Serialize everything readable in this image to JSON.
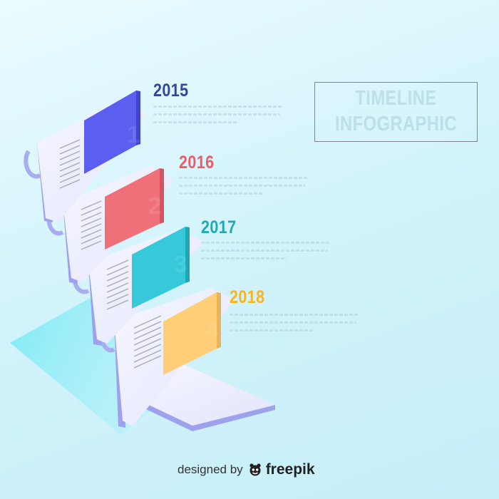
{
  "title": {
    "line1": "TIMELINE",
    "line2": "INFOGRAPHIC"
  },
  "steps": [
    {
      "year": "2015",
      "color": "#5b5ff0",
      "year_color": "#33479a"
    },
    {
      "year": "2016",
      "color": "#f0707a",
      "year_color": "#ec5b67"
    },
    {
      "year": "2017",
      "color": "#35c9da",
      "year_color": "#22a8b4"
    },
    {
      "year": "2018",
      "color": "#ffce77",
      "year_color": "#f6b623"
    }
  ],
  "credit": {
    "prefix": "designed by",
    "brand": "freepik"
  },
  "icons": {
    "brand_logo": "freepik-logo-icon"
  }
}
